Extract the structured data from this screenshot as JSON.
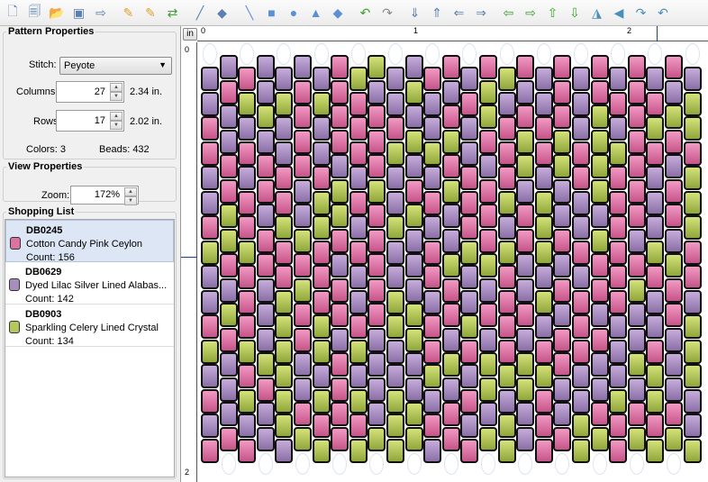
{
  "toolbar": {
    "buttons": [
      "new-pattern",
      "open-pattern",
      "open-folder",
      "import-image",
      "export-image",
      "add-color",
      "remove-color",
      "shuffle",
      "color-picker",
      "fill",
      "line",
      "rectangle",
      "circle",
      "triangle",
      "diamond",
      "undo",
      "redo",
      "insert-column",
      "delete-column",
      "insert-row",
      "delete-row",
      "shift-left",
      "shift-right",
      "shift-up",
      "shift-down",
      "flip-horizontal",
      "flip-vertical",
      "rotate-right",
      "rotate-left"
    ]
  },
  "pattern": {
    "title": "Pattern Properties",
    "stitch_label": "Stitch:",
    "stitch_value": "Peyote",
    "columns_label": "Columns:",
    "columns_value": "27",
    "columns_size": "2.34 in.",
    "rows_label": "Rows:",
    "rows_value": "17",
    "rows_size": "2.02 in.",
    "colors_label": "Colors:",
    "colors_value": "3",
    "beads_label": "Beads:",
    "beads_value": "432"
  },
  "view": {
    "title": "View Properties",
    "zoom_label": "Zoom:",
    "zoom_value": "172%"
  },
  "shopping": {
    "title": "Shopping List",
    "items": [
      {
        "code": "DB0245",
        "name": "Cotton Candy Pink Ceylon",
        "count": "Count: 156",
        "color": "#d9739f"
      },
      {
        "code": "DB0629",
        "name": "Dyed Lilac Silver Lined Alabas...",
        "count": "Count: 142",
        "color": "#a88ec0"
      },
      {
        "code": "DB0903",
        "name": "Sparkling Celery Lined Crystal",
        "count": "Count: 134",
        "color": "#b5c65a"
      }
    ]
  },
  "canvas": {
    "unit": "in",
    "top_ruler": [
      "0",
      "1",
      "2"
    ],
    "left_ruler": [
      "0",
      "2"
    ]
  }
}
